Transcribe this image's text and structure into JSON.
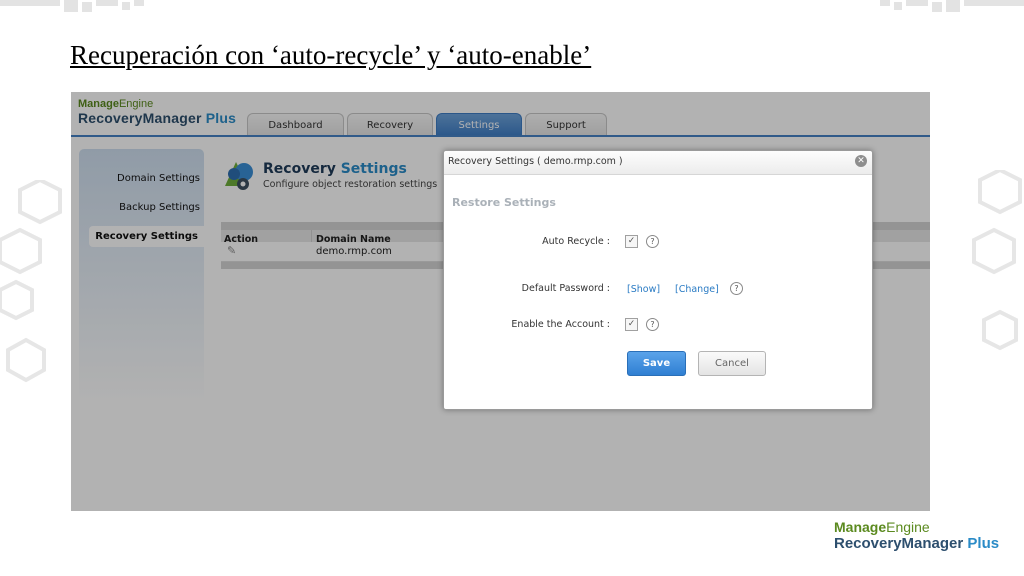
{
  "slide": {
    "title": "Recuperación con ‘auto-recycle’ y ‘auto-enable’"
  },
  "app": {
    "brand_company_bold": "Manage",
    "brand_company_rest": "Engine",
    "brand_product_main": "RecoveryManager",
    "brand_product_plus": "Plus",
    "tabs": [
      {
        "label": "Dashboard",
        "active": false
      },
      {
        "label": "Recovery",
        "active": false
      },
      {
        "label": "Settings",
        "active": true
      },
      {
        "label": "Support",
        "active": false
      }
    ],
    "sidebar": {
      "items": [
        {
          "label": "Domain Settings",
          "active": false
        },
        {
          "label": "Backup Settings",
          "active": false
        },
        {
          "label": "Recovery Settings",
          "active": true
        }
      ]
    },
    "content": {
      "title_main": "Recovery",
      "title_accent": "Settings",
      "subtitle": "Configure object restoration settings",
      "table": {
        "headers": [
          "Action",
          "Domain Name"
        ],
        "rows": [
          {
            "action_icon": "edit-icon",
            "domain": "demo.rmp.com"
          }
        ]
      }
    },
    "dialog": {
      "title": "Recovery Settings ( demo.rmp.com )",
      "section": "Restore Settings",
      "auto_recycle_label": "Auto Recycle :",
      "auto_recycle_checked": true,
      "default_password_label": "Default Password :",
      "show_link": "[Show]",
      "change_link": "[Change]",
      "enable_account_label": "Enable the Account :",
      "enable_account_checked": true,
      "save_label": "Save",
      "cancel_label": "Cancel",
      "help_glyph": "?"
    }
  },
  "footer_brand": {
    "company_bold": "Manage",
    "company_rest": "Engine",
    "product_main": "RecoveryManager",
    "product_plus": "Plus"
  },
  "colors": {
    "accent_blue": "#3e7dc5",
    "brand_green": "#5b8a1f",
    "brand_navy": "#2d4f6e",
    "link_blue": "#2a7bc4"
  }
}
